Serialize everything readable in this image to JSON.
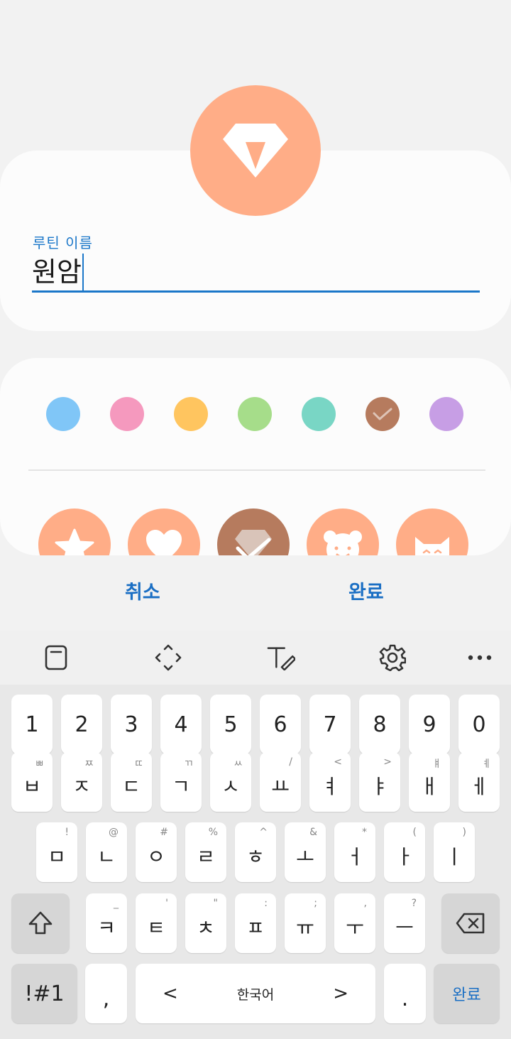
{
  "routine": {
    "name_label": "루틴 이름",
    "name_value": "원암"
  },
  "colors": {
    "accent": "#1b77c9",
    "selected_icon_bg": "#ffad87",
    "swatches": [
      "#80c6f7",
      "#f599be",
      "#ffc55f",
      "#a6dd8a",
      "#79d6c5",
      "#b67b5e",
      "#c79ee5"
    ],
    "selected_swatch_index": 5
  },
  "icon_options": [
    "star-icon",
    "heart-icon",
    "diamond-icon",
    "bear-icon",
    "cat-icon"
  ],
  "selected_icon_index": 2,
  "actions": {
    "cancel": "취소",
    "done": "완료"
  },
  "toolbar": [
    "clipboard-icon",
    "cursor-move-icon",
    "handwriting-icon",
    "gear-icon",
    "more-icon"
  ],
  "keyboard": {
    "row_numbers": [
      "1",
      "2",
      "3",
      "4",
      "5",
      "6",
      "7",
      "8",
      "9",
      "0"
    ],
    "row1": [
      {
        "key": "ㅂ",
        "hint": "ㅃ"
      },
      {
        "key": "ㅈ",
        "hint": "ㅉ"
      },
      {
        "key": "ㄷ",
        "hint": "ㄸ"
      },
      {
        "key": "ㄱ",
        "hint": "ㄲ"
      },
      {
        "key": "ㅅ",
        "hint": "ㅆ"
      },
      {
        "key": "ㅛ",
        "hint": "/"
      },
      {
        "key": "ㅕ",
        "hint": "<"
      },
      {
        "key": "ㅑ",
        "hint": ">"
      },
      {
        "key": "ㅐ",
        "hint": "ㅒ"
      },
      {
        "key": "ㅔ",
        "hint": "ㅖ"
      }
    ],
    "row2": [
      {
        "key": "ㅁ",
        "hint": "!"
      },
      {
        "key": "ㄴ",
        "hint": "@"
      },
      {
        "key": "ㅇ",
        "hint": "#"
      },
      {
        "key": "ㄹ",
        "hint": "%"
      },
      {
        "key": "ㅎ",
        "hint": "^"
      },
      {
        "key": "ㅗ",
        "hint": "&"
      },
      {
        "key": "ㅓ",
        "hint": "*"
      },
      {
        "key": "ㅏ",
        "hint": "("
      },
      {
        "key": "ㅣ",
        "hint": ")"
      }
    ],
    "row3": [
      {
        "key": "ㅋ",
        "hint": "_"
      },
      {
        "key": "ㅌ",
        "hint": "'"
      },
      {
        "key": "ㅊ",
        "hint": "\""
      },
      {
        "key": "ㅍ",
        "hint": ":"
      },
      {
        "key": "ㅠ",
        "hint": ";"
      },
      {
        "key": "ㅜ",
        "hint": ","
      },
      {
        "key": "ㅡ",
        "hint": "?"
      }
    ],
    "symbols_label": "!#1",
    "comma_label": ",",
    "space_label": "한국어",
    "left_arrow": "<",
    "right_arrow": ">",
    "period_label": ".",
    "enter_label": "완료"
  }
}
